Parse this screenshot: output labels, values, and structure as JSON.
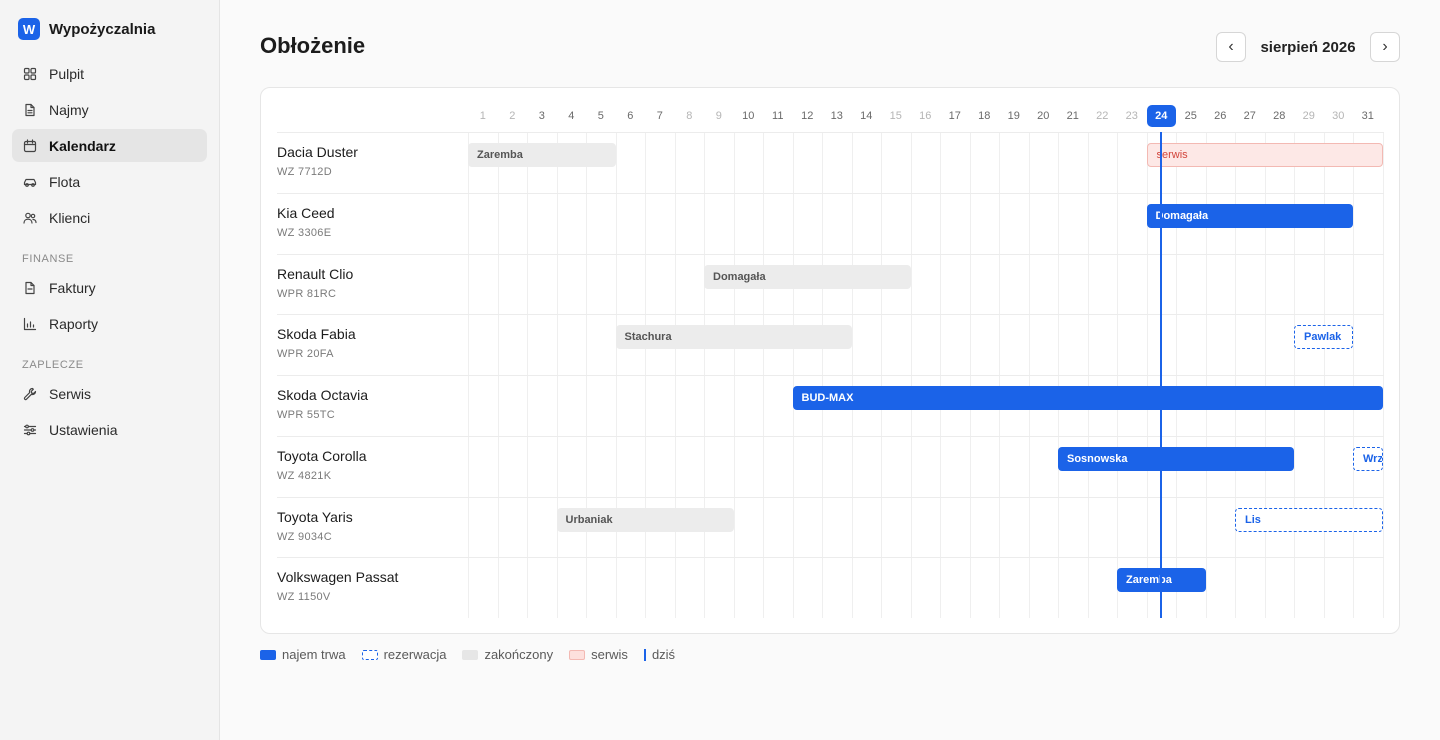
{
  "app": {
    "logo_letter": "W",
    "name": "Wypożyczalnia"
  },
  "sidebar": {
    "items": [
      {
        "label": "Pulpit",
        "icon": "grid-icon",
        "active": false
      },
      {
        "label": "Najmy",
        "icon": "document-icon",
        "active": false
      },
      {
        "label": "Kalendarz",
        "icon": "calendar-icon",
        "active": true
      },
      {
        "label": "Flota",
        "icon": "car-icon",
        "active": false
      },
      {
        "label": "Klienci",
        "icon": "users-icon",
        "active": false
      }
    ],
    "sections": [
      {
        "title": "FINANSE",
        "items": [
          {
            "label": "Faktury",
            "icon": "invoice-icon"
          },
          {
            "label": "Raporty",
            "icon": "chart-icon"
          }
        ]
      },
      {
        "title": "ZAPLECZE",
        "items": [
          {
            "label": "Serwis",
            "icon": "wrench-icon"
          },
          {
            "label": "Ustawienia",
            "icon": "sliders-icon"
          }
        ]
      }
    ]
  },
  "header": {
    "title": "Obłożenie",
    "month_label": "sierpień 2026",
    "prev_label": "‹",
    "next_label": "›"
  },
  "calendar": {
    "days": 31,
    "weekend_days": [
      1,
      2,
      8,
      9,
      15,
      16,
      22,
      23,
      29,
      30
    ],
    "today": 24,
    "vehicles": [
      {
        "name": "Dacia Duster",
        "plate": "WZ 7712D",
        "bookings": [
          {
            "label": "Zaremba",
            "status": "finished",
            "start": 1,
            "end": 5
          },
          {
            "label": "serwis",
            "status": "service",
            "start": 24,
            "end": 31
          }
        ]
      },
      {
        "name": "Kia Ceed",
        "plate": "WZ 3306E",
        "bookings": [
          {
            "label": "Domagała",
            "status": "ongoing",
            "start": 24,
            "end": 30
          }
        ]
      },
      {
        "name": "Renault Clio",
        "plate": "WPR 81RC",
        "bookings": [
          {
            "label": "Domagała",
            "status": "finished",
            "start": 9,
            "end": 15
          }
        ]
      },
      {
        "name": "Skoda Fabia",
        "plate": "WPR 20FA",
        "bookings": [
          {
            "label": "Stachura",
            "status": "finished",
            "start": 6,
            "end": 13
          },
          {
            "label": "Pawlak",
            "status": "reserved",
            "start": 29,
            "end": 30
          }
        ]
      },
      {
        "name": "Skoda Octavia",
        "plate": "WPR 55TC",
        "bookings": [
          {
            "label": "BUD-MAX",
            "status": "ongoing",
            "start": 12,
            "end": 31
          }
        ]
      },
      {
        "name": "Toyota Corolla",
        "plate": "WZ 4821K",
        "bookings": [
          {
            "label": "Sosnowska",
            "status": "ongoing",
            "start": 21,
            "end": 28
          },
          {
            "label": "Wrz",
            "status": "reserved",
            "start": 31,
            "end": 31
          }
        ]
      },
      {
        "name": "Toyota Yaris",
        "plate": "WZ 9034C",
        "bookings": [
          {
            "label": "Urbaniak",
            "status": "finished",
            "start": 4,
            "end": 9
          },
          {
            "label": "Lis",
            "status": "reserved",
            "start": 27,
            "end": 31
          }
        ]
      },
      {
        "name": "Volkswagen Passat",
        "plate": "WZ 1150V",
        "bookings": [
          {
            "label": "Zaremba",
            "status": "ongoing",
            "start": 23,
            "end": 25
          }
        ]
      }
    ]
  },
  "legend": [
    {
      "key": "ongoing",
      "label": "najem trwa"
    },
    {
      "key": "reserved",
      "label": "rezerwacja"
    },
    {
      "key": "finished",
      "label": "zakończony"
    },
    {
      "key": "service",
      "label": "serwis"
    },
    {
      "key": "today",
      "label": "dziś"
    }
  ],
  "colors": {
    "accent": "#1b63e8",
    "finished": "#ececec",
    "service_bg": "#fde8e6",
    "service_text": "#d2453b"
  }
}
